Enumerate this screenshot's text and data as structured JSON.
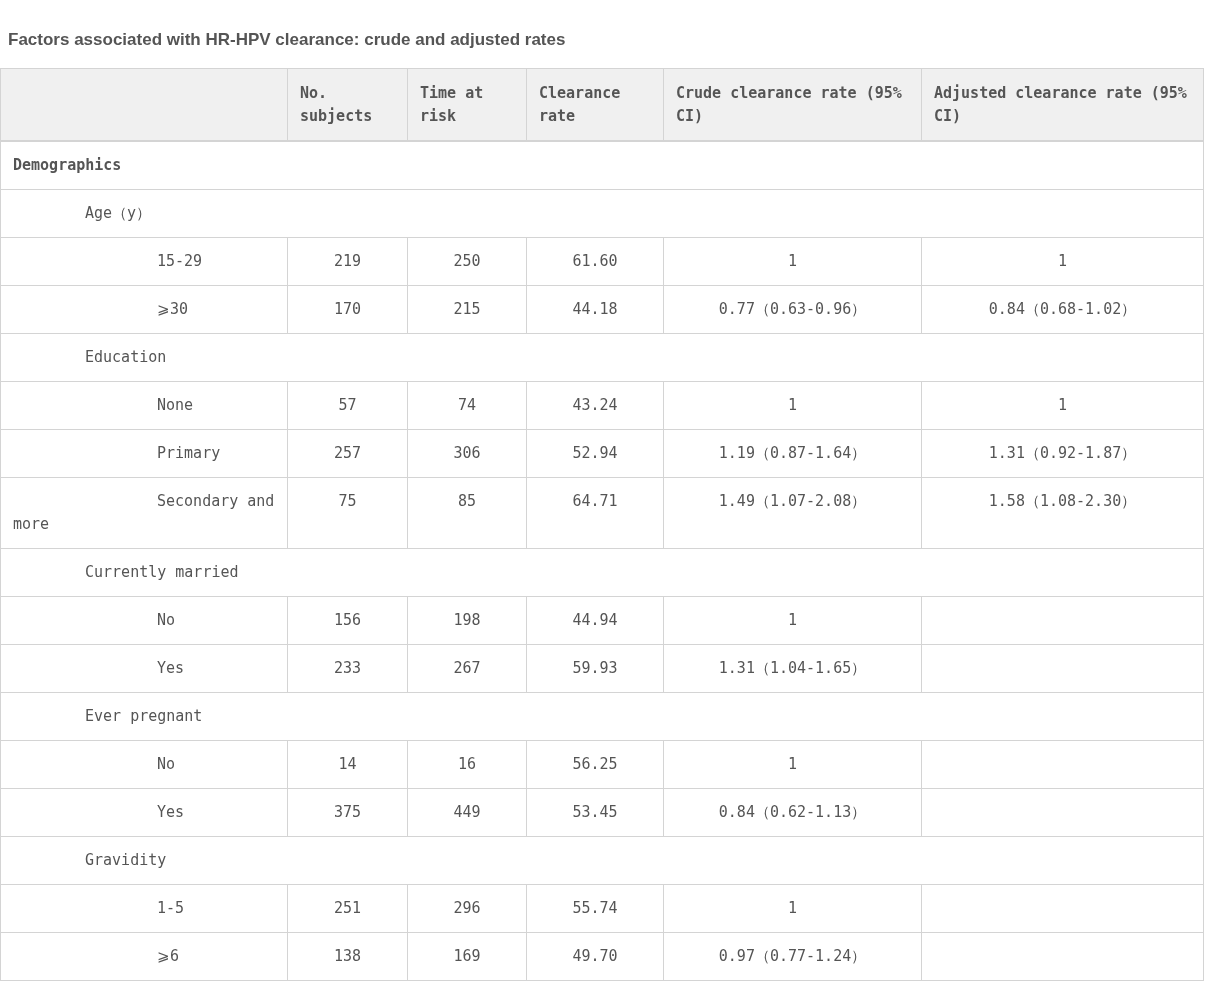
{
  "title": "Factors associated with HR-HPV clearance: crude and adjusted rates",
  "table": {
    "columns": [
      "",
      "No. subjects",
      "Time at risk",
      "Clearance rate",
      "Crude clearance rate (95% CI)",
      "Adjusted clearance rate (95% CI)"
    ],
    "sections": [
      {
        "label": "Demographics",
        "children": [
          {
            "label": "Age（y）",
            "children": [
              {
                "label": "15-29",
                "values": [
                  "219",
                  "250",
                  "61.60",
                  "1",
                  "1"
                ]
              },
              {
                "label": "⩾30",
                "values": [
                  "170",
                  "215",
                  "44.18",
                  "0.77（0.63-0.96）",
                  "0.84（0.68-1.02）"
                ]
              }
            ]
          },
          {
            "label": "Education",
            "children": [
              {
                "label": "None",
                "values": [
                  "57",
                  "74",
                  "43.24",
                  "1",
                  "1"
                ]
              },
              {
                "label": "Primary",
                "values": [
                  "257",
                  "306",
                  "52.94",
                  "1.19（0.87-1.64）",
                  "1.31（0.92-1.87）"
                ]
              },
              {
                "label": "Secondary and more",
                "values": [
                  "75",
                  "85",
                  "64.71",
                  "1.49（1.07-2.08）",
                  "1.58（1.08-2.30）"
                ]
              }
            ]
          },
          {
            "label": "Currently married",
            "children": [
              {
                "label": "No",
                "values": [
                  "156",
                  "198",
                  "44.94",
                  "1"
                ]
              },
              {
                "label": "Yes",
                "values": [
                  "233",
                  "267",
                  "59.93",
                  "1.31（1.04-1.65）"
                ]
              }
            ]
          },
          {
            "label": "Ever pregnant",
            "children": [
              {
                "label": "No",
                "values": [
                  "14",
                  "16",
                  "56.25",
                  "1"
                ]
              },
              {
                "label": "Yes",
                "values": [
                  "375",
                  "449",
                  "53.45",
                  "0.84（0.62-1.13）"
                ]
              }
            ]
          },
          {
            "label": "Gravidity",
            "children": [
              {
                "label": "1-5",
                "values": [
                  "251",
                  "296",
                  "55.74",
                  "1"
                ]
              },
              {
                "label": "⩾6",
                "values": [
                  "138",
                  "169",
                  "49.70",
                  "0.97（0.77-1.24）"
                ]
              }
            ]
          }
        ]
      }
    ]
  }
}
